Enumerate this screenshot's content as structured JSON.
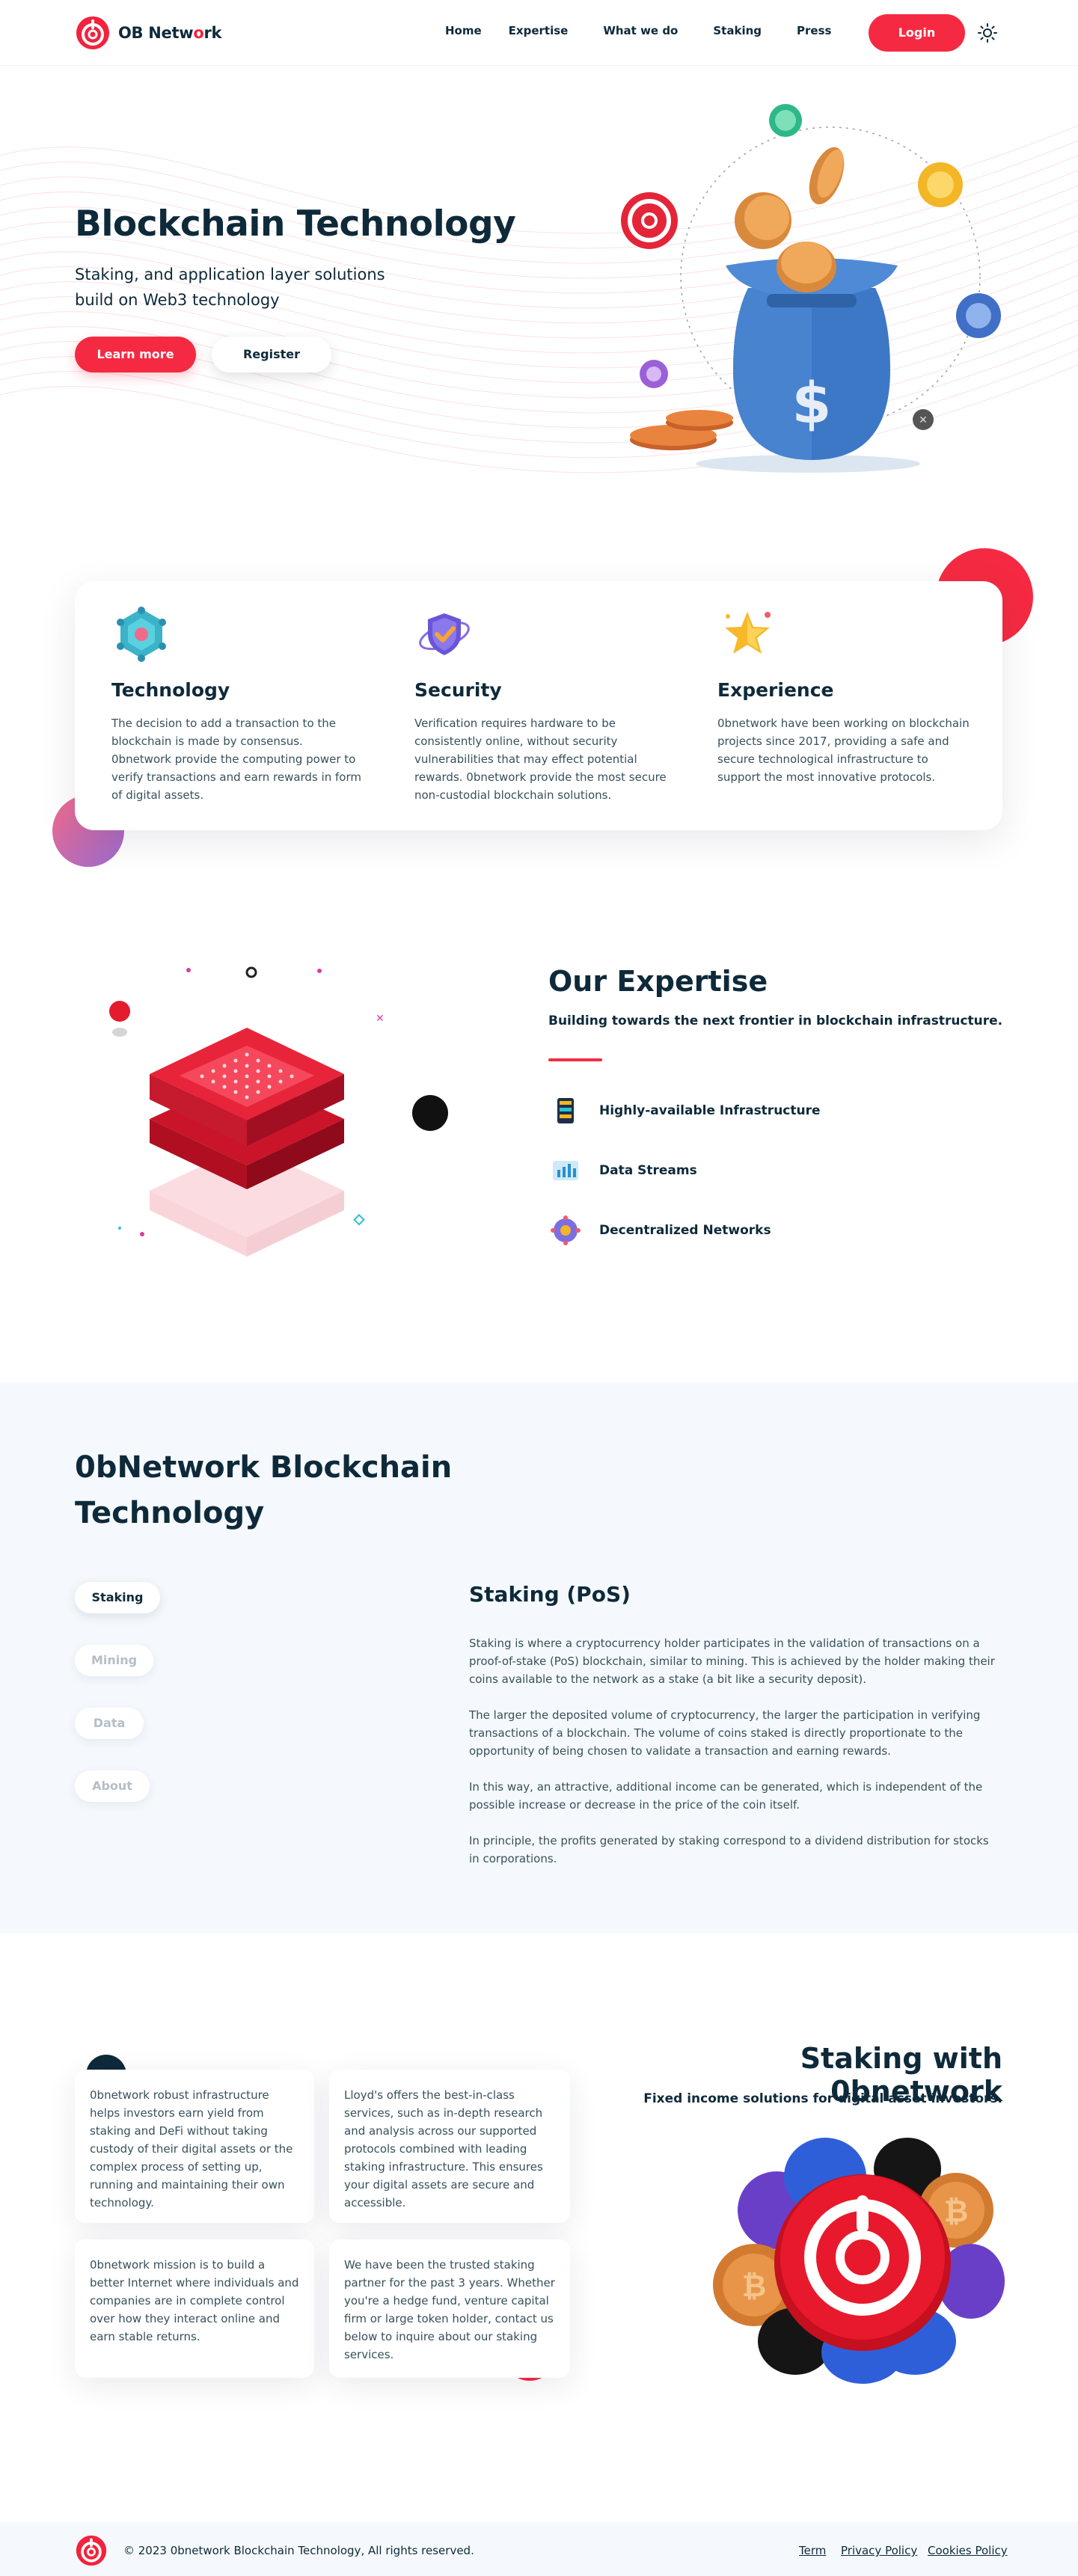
{
  "header": {
    "brand_prefix": "OB Netw",
    "brand_o": "o",
    "brand_suffix": "rk",
    "nav": [
      "Home",
      "Expertise",
      "What we do",
      "Staking",
      "Press"
    ],
    "login": "Login",
    "theme_icon": "sun-icon"
  },
  "hero": {
    "title": "Blockchain Technology",
    "subtitle": "Staking, and application layer solutions build on Web3 technology",
    "learn_more": "Learn more",
    "register": "Register"
  },
  "features": [
    {
      "icon": "network-icon",
      "title": "Technology",
      "text": "The decision to add a transaction to the blockchain is made by consensus. 0bnetwork provide the computing power to verify transactions and earn rewards in form of digital assets."
    },
    {
      "icon": "shield-check-icon",
      "title": "Security",
      "text": "Verification requires hardware to be consistently online, without security vulnerabilities that may effect potential rewards. 0bnetwork provide the most secure non-custodial blockchain solutions."
    },
    {
      "icon": "star-icon",
      "title": "Experience",
      "text": "0bnetwork have been working on blockchain projects since 2017, providing a safe and secure technological infrastructure to support the most innovative protocols."
    }
  ],
  "expertise": {
    "title": "Our Expertise",
    "subtitle": "Building towards the next frontier in blockchain infrastructure.",
    "items": [
      {
        "icon": "server-icon",
        "label": "Highly-available Infrastructure"
      },
      {
        "icon": "data-stream-icon",
        "label": "Data Streams"
      },
      {
        "icon": "decentralized-network-icon",
        "label": "Decentralized Networks"
      }
    ]
  },
  "tech": {
    "title": "0bNetwork Blockchain Technology",
    "tabs": [
      "Staking",
      "Mining",
      "Data",
      "About"
    ],
    "active_tab": "Staking",
    "content_title": "Staking (PoS)",
    "paragraphs": [
      "Staking is where a cryptocurrency holder participates in the validation of transactions on a proof-of-stake (PoS) blockchain, similar to mining. This is achieved by the holder making their coins available to the network as a stake (a bit like a security deposit).",
      "The larger the deposited volume of cryptocurrency, the larger the participation in verifying transactions of a blockchain. The volume of coins staked is directly proportionate to the opportunity of being chosen to validate a transaction and earning rewards.",
      "In this way, an attractive, additional income can be generated, which is independent of the possible increase or decrease in the price of the coin itself.",
      "In principle, the profits generated by staking correspond to a dividend distribution for stocks in corporations."
    ]
  },
  "staking": {
    "title": "Staking with 0bnetwork",
    "subtitle": "Fixed income solutions for digital asset investors.",
    "boxes": [
      "0bnetwork robust infrastructure helps investors earn yield from staking and DeFi without taking custody of their digital assets or the complex process of setting up, running and maintaining their own technology.",
      "Lloyd's offers the best-in-class services, such as in-depth research and analysis across our supported protocols combined with leading staking infrastructure. This ensures your digital assets are secure and accessible.",
      "0bnetwork mission is to build a better Internet where individuals and companies are in complete control over how they interact online and earn stable returns.",
      "We have been the trusted staking partner for the past 3 years. Whether you're a hedge fund, venture capital firm or large token holder, contact us below to inquire about our staking services."
    ]
  },
  "footer": {
    "copyright": "© 2023 0bnetwork Blockchain Technology, All rights reserved.",
    "links": [
      "Term",
      "Privacy Policy",
      "Cookies Policy"
    ]
  },
  "colors": {
    "accent": "#f52a42",
    "text": "#0e2a3a",
    "muted": "#38505c",
    "section_bg": "#f5f9fd"
  }
}
